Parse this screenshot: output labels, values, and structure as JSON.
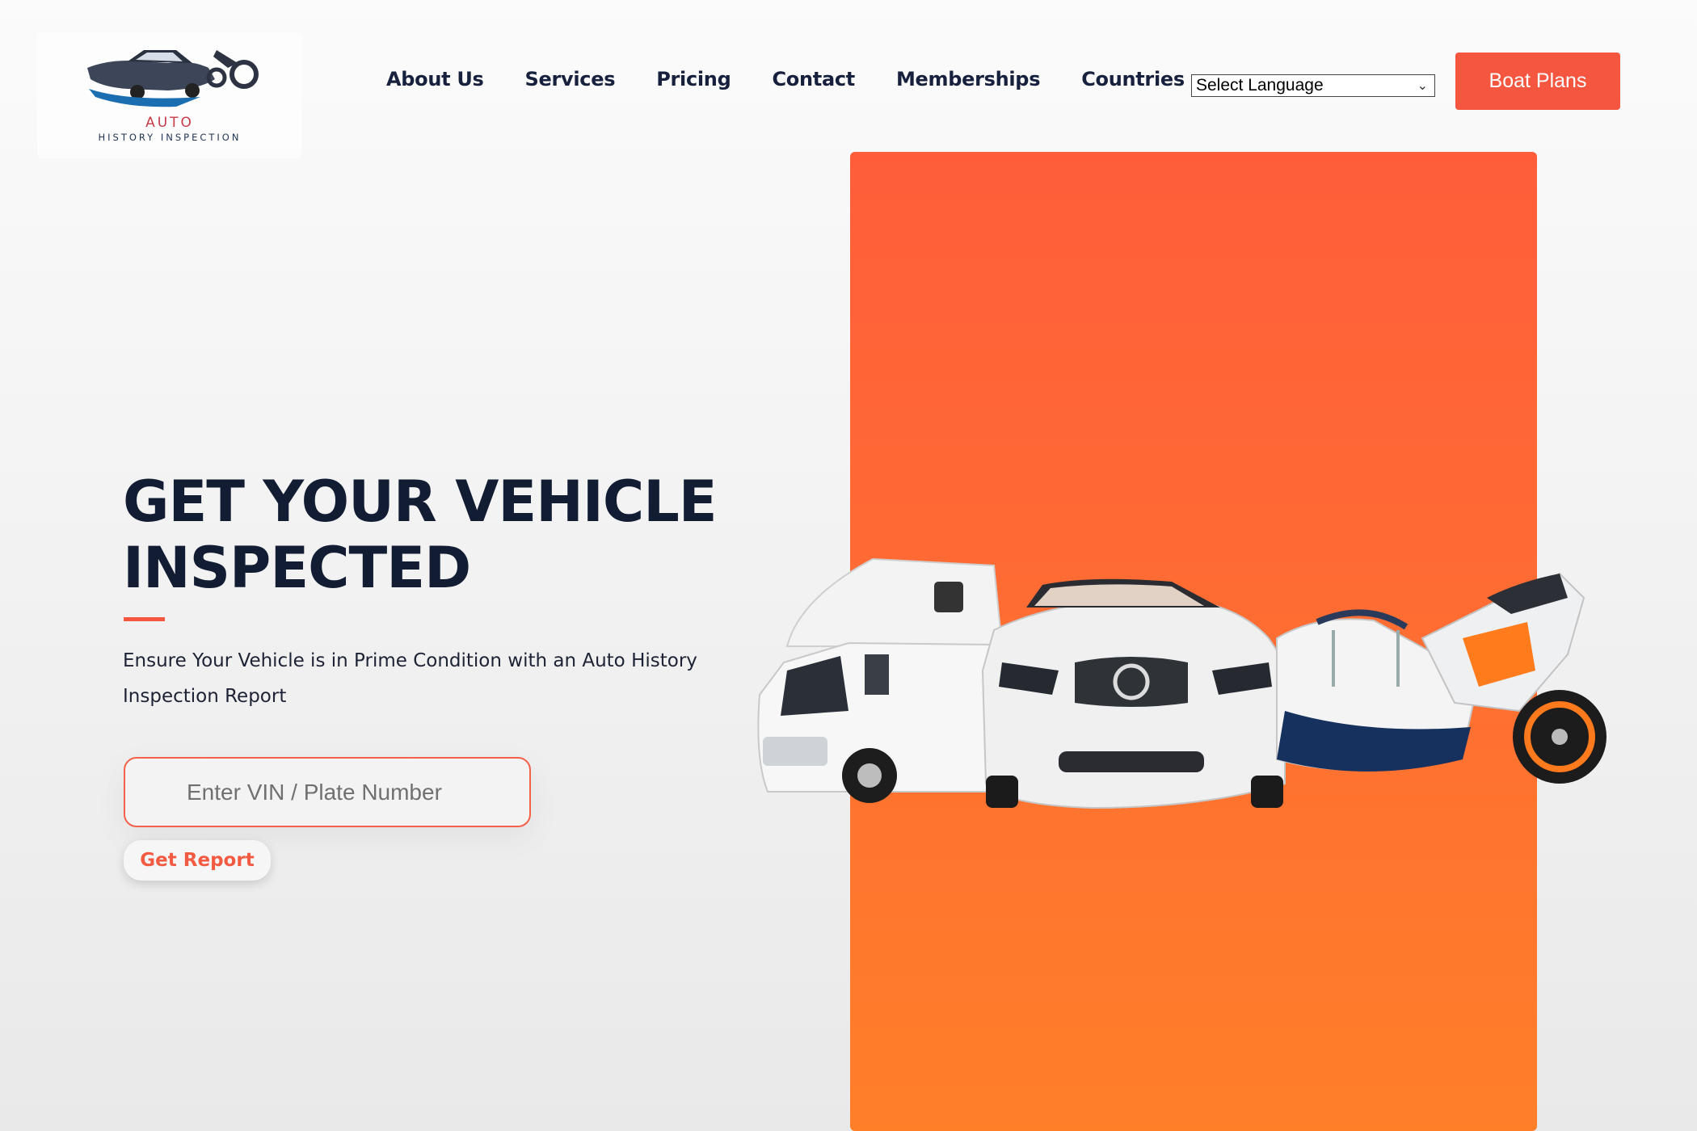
{
  "header": {
    "logo": {
      "word": "AUTO",
      "subtitle": "HISTORY INSPECTION"
    },
    "nav": [
      "About Us",
      "Services",
      "Pricing",
      "Contact",
      "Memberships",
      "Countries"
    ],
    "language_select": "Select Language",
    "cta_label": "Boat Plans"
  },
  "hero": {
    "title": "GET YOUR VEHICLE INSPECTED",
    "subtitle": "Ensure Your Vehicle is in Prime Condition with an Auto History Inspection Report",
    "input_placeholder": "Enter VIN / Plate Number",
    "button_label": "Get Report"
  },
  "colors": {
    "accent": "#f4563f",
    "panel_top": "#ff5d3a",
    "panel_bottom": "#ff7f29",
    "heading": "#121c33"
  },
  "icons": [
    "logo-vehicles-icon",
    "chevron-down-icon"
  ]
}
